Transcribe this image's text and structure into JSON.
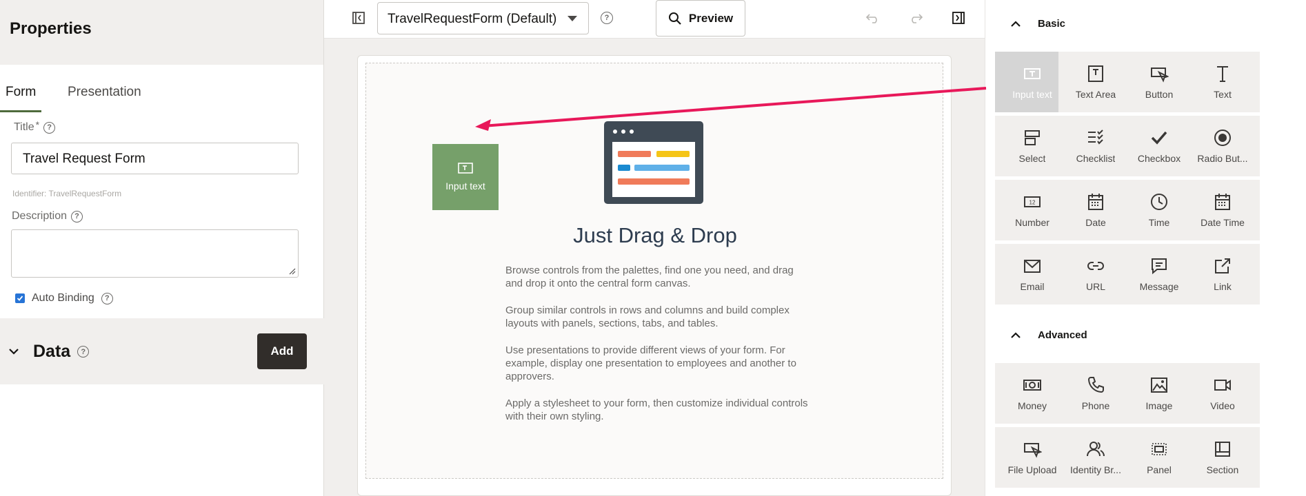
{
  "left": {
    "title": "Properties",
    "tabs": [
      {
        "label": "Form"
      },
      {
        "label": "Presentation"
      }
    ],
    "title_label": "Title",
    "required_mark": "*",
    "title_value": "Travel Request Form",
    "identifier": "Identifier: TravelRequestForm",
    "description_label": "Description",
    "auto_binding_label": "Auto Binding",
    "data_section_title": "Data",
    "add_label": "Add"
  },
  "toolbar": {
    "form_select": "TravelRequestForm (Default)",
    "preview_label": "Preview"
  },
  "canvas": {
    "drag_tile_label": "Input text",
    "heading": "Just Drag & Drop",
    "paragraphs": [
      "Browse controls from the palettes, find one you need, and drag and drop it onto the central form canvas.",
      "Group similar controls in rows and columns and build complex layouts with panels, sections, tabs, and tables.",
      "Use presentations to provide different views of your form. For example, display one presentation to employees and another to approvers.",
      "Apply a stylesheet to your form, then customize individual controls with their own styling."
    ]
  },
  "palette": {
    "basic_label": "Basic",
    "advanced_label": "Advanced",
    "basic": [
      {
        "label": "Input text",
        "icon": "input-text-icon"
      },
      {
        "label": "Text Area",
        "icon": "text-area-icon"
      },
      {
        "label": "Button",
        "icon": "button-icon"
      },
      {
        "label": "Text",
        "icon": "text-icon"
      },
      {
        "label": "Select",
        "icon": "select-icon"
      },
      {
        "label": "Checklist",
        "icon": "checklist-icon"
      },
      {
        "label": "Checkbox",
        "icon": "checkbox-icon"
      },
      {
        "label": "Radio But...",
        "icon": "radio-button-icon"
      },
      {
        "label": "Number",
        "icon": "number-icon"
      },
      {
        "label": "Date",
        "icon": "date-icon"
      },
      {
        "label": "Time",
        "icon": "time-icon"
      },
      {
        "label": "Date Time",
        "icon": "date-time-icon"
      },
      {
        "label": "Email",
        "icon": "email-icon"
      },
      {
        "label": "URL",
        "icon": "url-icon"
      },
      {
        "label": "Message",
        "icon": "message-icon"
      },
      {
        "label": "Link",
        "icon": "link-icon"
      }
    ],
    "advanced": [
      {
        "label": "Money",
        "icon": "money-icon"
      },
      {
        "label": "Phone",
        "icon": "phone-icon"
      },
      {
        "label": "Image",
        "icon": "image-icon"
      },
      {
        "label": "Video",
        "icon": "video-icon"
      },
      {
        "label": "File Upload",
        "icon": "file-upload-icon"
      },
      {
        "label": "Identity Br...",
        "icon": "identity-browser-icon"
      },
      {
        "label": "Panel",
        "icon": "panel-icon"
      },
      {
        "label": "Section",
        "icon": "section-icon"
      }
    ]
  },
  "colors": {
    "accent_green": "#76a06a",
    "arrow": "#e8185a",
    "checkbox_blue": "#2774d6",
    "dark_button": "#312d2a"
  }
}
